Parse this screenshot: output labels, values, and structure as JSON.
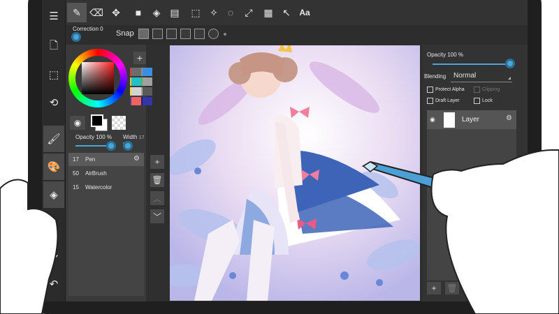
{
  "rail": {
    "items": [
      {
        "name": "menu-icon",
        "glyph": "☰"
      },
      {
        "name": "file-icon",
        "glyph": "🗋"
      },
      {
        "name": "selection-icon",
        "glyph": "⬚"
      },
      {
        "name": "rotate-icon",
        "glyph": "⟲"
      },
      {
        "name": "brush-icon",
        "glyph": "🖌"
      },
      {
        "name": "palette-icon",
        "glyph": "🎨"
      },
      {
        "name": "layers-icon",
        "glyph": "◈"
      },
      {
        "name": "redo-icon",
        "glyph": "↷"
      },
      {
        "name": "undo-icon",
        "glyph": "↶"
      }
    ]
  },
  "toolbar": {
    "tools": [
      {
        "name": "pen-tool-icon",
        "glyph": "✎"
      },
      {
        "name": "eraser-tool-icon",
        "glyph": "⌫"
      },
      {
        "name": "move-tool-icon",
        "glyph": "✥"
      },
      {
        "name": "fill-rect-tool-icon",
        "glyph": "■"
      },
      {
        "name": "bucket-tool-icon",
        "glyph": "◈"
      },
      {
        "name": "gradient-tool-icon",
        "glyph": "▤"
      },
      {
        "name": "select-rect-tool-icon",
        "glyph": "⬚"
      },
      {
        "name": "magic-wand-tool-icon",
        "glyph": "✧"
      },
      {
        "name": "lasso-tool-icon",
        "glyph": "◌"
      },
      {
        "name": "transform-tool-icon",
        "glyph": "⤢"
      },
      {
        "name": "frame-tool-icon",
        "glyph": "▦"
      },
      {
        "name": "cursor-tool-icon",
        "glyph": "↖"
      }
    ],
    "text_tool": "Aa"
  },
  "subbar": {
    "correction_label": "Correction 0",
    "snap_label": "Snap"
  },
  "colors": {
    "accent": "#4aa6d8",
    "panel": "#3a3a3a",
    "swatches": [
      "#e53935",
      "#8e8e8e",
      "#6d6d6d",
      "#3b8fe0",
      "#f4c21b",
      "#4fb84f",
      "#22c0c8",
      "#a0a0a0",
      "#f0e020",
      "#a4a4a4",
      "#d3d3d3",
      "#5a5a5a",
      "#444488",
      "#222266",
      "#f06262",
      "#3333aa"
    ]
  },
  "brush": {
    "opacity_label": "Opacity 100 %",
    "width_label": "Width",
    "width_value": "17 px",
    "list": [
      {
        "size": "17",
        "name": "Pen"
      },
      {
        "size": "50",
        "name": "AirBrush"
      },
      {
        "size": "15",
        "name": "Watercolor"
      }
    ]
  },
  "layers_panel": {
    "opacity_label": "Opacity 100 %",
    "blending_label": "Blending",
    "blending_value": "Normal",
    "protect_alpha": "Protect Alpha",
    "clipping": "Clipping",
    "draft_layer": "Draft Layer",
    "lock": "Lock",
    "layer_name": "Layer"
  }
}
